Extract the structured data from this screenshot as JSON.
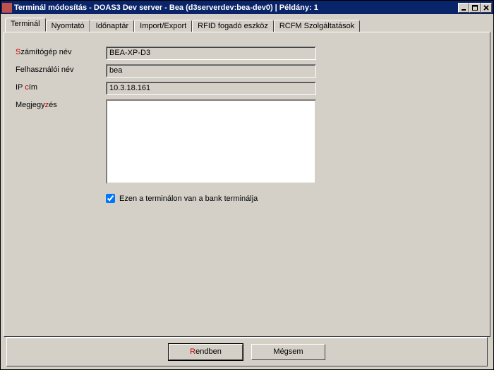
{
  "titlebar": {
    "text": "Terminál módosítás - DOAS3 Dev server - Bea (d3serverdev:bea-dev0) | Példány: 1"
  },
  "tabs": [
    {
      "label": "Terminál"
    },
    {
      "label": "Nyomtató"
    },
    {
      "label": "Időnaptár"
    },
    {
      "label": "Import/Export"
    },
    {
      "label": "RFID fogadó eszköz"
    },
    {
      "label": "RCFM Szolgáltatások"
    }
  ],
  "form": {
    "computer_label_pre": "S",
    "computer_label": "zámítógép név",
    "computer_value": "BEA-XP-D3",
    "user_label": "Felhasználói név",
    "user_value": "bea",
    "ip_label_a": "IP ",
    "ip_label_hot": "c",
    "ip_label_b": "ím",
    "ip_value": "10.3.18.161",
    "note_label_a": "Megjegy",
    "note_label_hot": "z",
    "note_label_b": "és",
    "note_value": "",
    "bank_terminal_label": "Ezen a terminálon van a bank terminálja"
  },
  "buttons": {
    "ok_hot": "R",
    "ok_rest": "endben",
    "cancel": "Mégsem"
  }
}
